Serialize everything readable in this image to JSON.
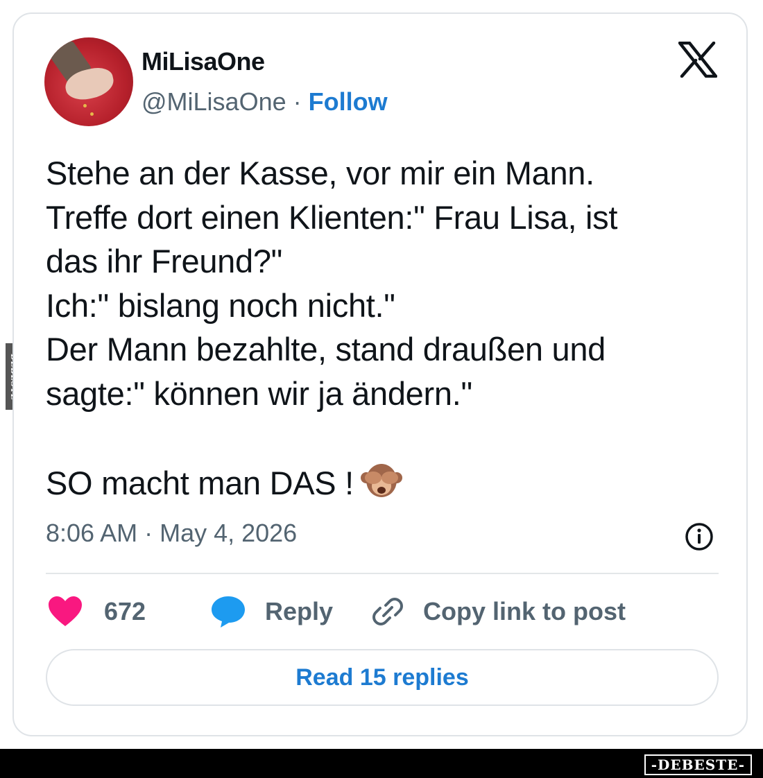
{
  "author": {
    "display_name": "MiLisaOne",
    "handle": "@MiLisaOne",
    "separator": " · ",
    "follow_label": "Follow"
  },
  "tweet": {
    "lines": [
      "Stehe an der Kasse, vor mir ein Mann.",
      "Treffe dort einen Klienten:\" Frau Lisa, ist",
      "das ihr Freund?\"",
      "Ich:\" bislang noch nicht.\"",
      "Der Mann bezahlte, stand draußen und",
      "sagte:\" können wir ja ändern.\"",
      "",
      "SO macht man DAS !"
    ],
    "emoji": "see-no-evil-monkey",
    "timestamp": "8:06 AM · May 4, 2026"
  },
  "actions": {
    "like_count": "672",
    "reply_label": "Reply",
    "copy_label": "Copy link to post"
  },
  "read_replies_label": "Read 15 replies",
  "watermark": {
    "side_text": "DEBESTE",
    "footer_text": "-DEBESTE-"
  },
  "colors": {
    "accent": "#1d7bd1",
    "like": "#f91880",
    "reply_bubble": "#1d9bf0",
    "muted": "#536471"
  }
}
